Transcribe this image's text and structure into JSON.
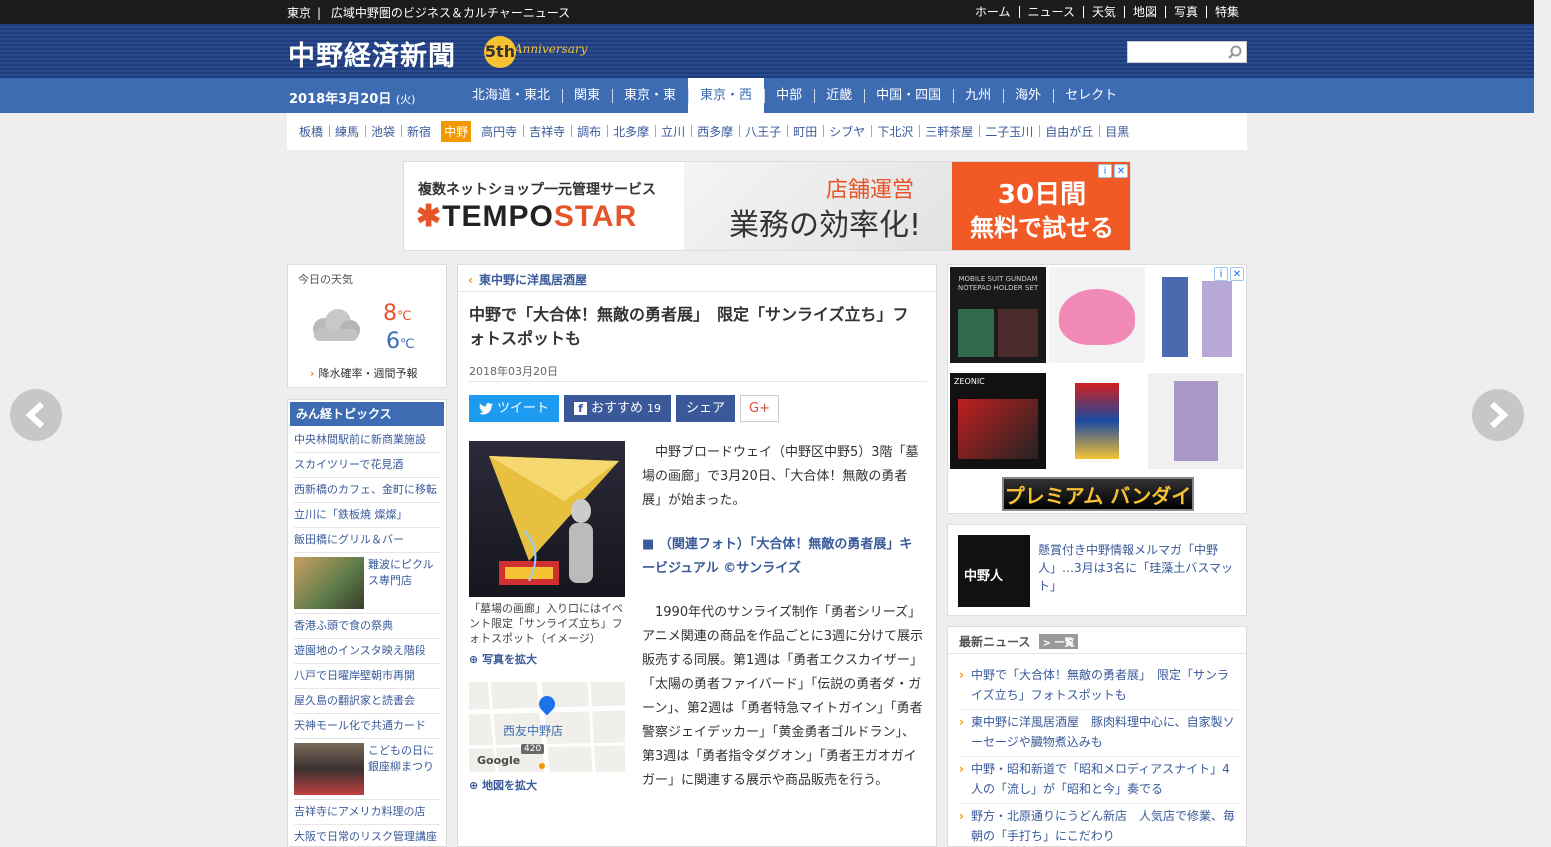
{
  "topbar": {
    "region": "東京",
    "tagline": "広域中野圏のビジネス＆カルチャーニュース",
    "nav": [
      "ホーム",
      "ニュース",
      "天気",
      "地図",
      "写真",
      "特集"
    ]
  },
  "header": {
    "logo": "中野経済新聞",
    "anniv_num": "5th",
    "anniv_text": "Anniversary",
    "search_placeholder": ""
  },
  "date": {
    "main": "2018年3月20日",
    "weekday": "(火)"
  },
  "regions": [
    "北海道・東北",
    "関東",
    "東京・東",
    "東京・西",
    "中部",
    "近畿",
    "中国・四国",
    "九州",
    "海外",
    "セレクト"
  ],
  "areas": [
    "板橋",
    "練馬",
    "池袋",
    "新宿",
    "中野",
    "高円寺",
    "吉祥寺",
    "調布",
    "北多摩",
    "立川",
    "西多摩",
    "八王子",
    "町田",
    "シブヤ",
    "下北沢",
    "三軒茶屋",
    "二子玉川",
    "自由が丘",
    "目黒"
  ],
  "banner": {
    "sub": "複数ネットショップ一元管理サービス",
    "brand_a": "TEMPO",
    "brand_b": "STAR",
    "l1": "店舗運営",
    "l2": "業務の効率化!",
    "c1": "30日間",
    "c2": "無料で試せる"
  },
  "weather": {
    "title": "今日の天気",
    "high": "8",
    "low": "6",
    "unit": "℃",
    "more": "降水確率・週間予報"
  },
  "topics": {
    "title": "みん経トピックス",
    "items": [
      "中央林間駅前に新商業施設",
      "スカイツリーで花見酒",
      "西新橋のカフェ、金町に移転",
      "立川に「鉄板焼 燦燦」",
      "飯田橋にグリル＆バー",
      "難波にピクルス専門店",
      "香港ふ頭で食の祭典",
      "遊園地のインスタ映え階段",
      "八戸で日曜岸壁朝市再開",
      "屋久島の翻訳家と読書会",
      "天神モール化で共通カード",
      "こどもの日に銀座柳まつり",
      "吉祥寺にアメリカ料理の店",
      "大阪で日常のリスク管理講座"
    ]
  },
  "article": {
    "crumb": "東中野に洋風居酒屋",
    "title": "中野で「大合体！無敵の勇者展」　限定「サンライズ立ち」フォトスポットも",
    "date": "2018年03月20日",
    "tweet": "ツイート",
    "recommend": "おすすめ",
    "recommend_count": "19",
    "share": "シェア",
    "gplus": "G+",
    "caption": "「墓場の画廊」入り口にはイベント限定「サンライズ立ち」フォトスポット（イメージ）",
    "zoom_photo": "写真を拡大",
    "map_label": "西友中野店",
    "map_road": "420",
    "map_brand": "Google",
    "zoom_map": "地図を拡大",
    "para1": "中野ブロードウェイ（中野区中野5）3階「墓場の画廊」で3月20日、「大合体！無敵の勇者展」が始まった。",
    "related": "（関連フォト）「大合体！無敵の勇者展」キービジュアル ©サンライズ",
    "para2": "1990年代のサンライズ制作「勇者シリーズ」アニメ関連の商品を作品ごとに3週に分けて展示販売する同展。第1週は「勇者エクスカイザー」「太陽の勇者ファイバード」「伝説の勇者ダ・ガーン」、第2週は「勇者特急マイトガイン」「勇者警察ジェイデッカー」「黄金勇者ゴルドラン」、第3週は「勇者指令ダグオン」「勇者王ガオガイガー」に関連する展示や商品販売を行う。"
  },
  "merch": {
    "p1": "MOBILE SUIT GUNDAM NOTEPAD HOLDER SET",
    "p4": "ZEONIC",
    "bandai": "プレミアム バンダイ"
  },
  "mail": {
    "img_text": "中野人",
    "text": "懸賞付き中野情報メルマガ「中野人」…3月は3名に「珪藻土バスマット」"
  },
  "news": {
    "title": "最新ニュース",
    "all": "一覧",
    "items": [
      "中野で「大合体！無敵の勇者展」　限定「サンライズ立ち」フォトスポットも",
      "東中野に洋風居酒屋　豚肉料理中心に、自家製ソーセージや臓物煮込みも",
      "中野・昭和新道で「昭和メロディアスナイト」4人の「流し」が「昭和と今」奏でる",
      "野方・北原通りにうどん新店　人気店で修業、毎朝の「手打ち」にこだわり"
    ]
  },
  "colors": {
    "brand": "#1f3c7c",
    "accent": "#f39800",
    "link": "#3a5a9a",
    "region_bar": "#3d6cb3"
  }
}
